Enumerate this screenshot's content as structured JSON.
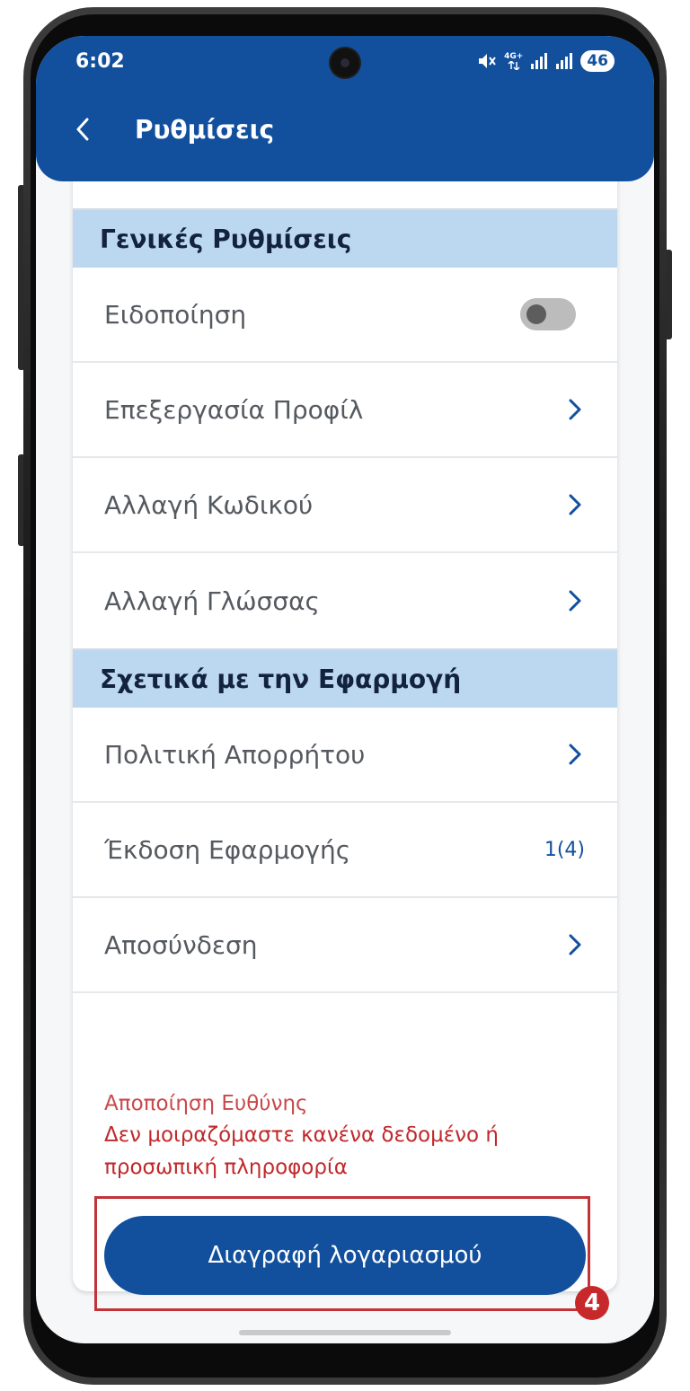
{
  "status_bar": {
    "time": "6:02",
    "network_label": "4G+",
    "battery": "46",
    "icons": [
      "mute-icon",
      "network-4g-icon",
      "signal-icon",
      "signal-icon",
      "battery-icon"
    ]
  },
  "header": {
    "back_icon": "chevron-left-icon",
    "title": "Ρυθμίσεις"
  },
  "sections": [
    {
      "title": "Γενικές Ρυθμίσεις",
      "items": [
        {
          "label": "Ειδοποίηση",
          "control": "toggle",
          "toggle_on": false
        },
        {
          "label": "Επεξεργασία Προφίλ",
          "control": "chevron"
        },
        {
          "label": "Αλλαγή Κωδικού",
          "control": "chevron"
        },
        {
          "label": "Αλλαγή Γλώσσας",
          "control": "chevron"
        }
      ]
    },
    {
      "title": "Σχετικά με την Εφαρμογή",
      "items": [
        {
          "label": "Πολιτική Απορρήτου",
          "control": "chevron"
        },
        {
          "label": "Έκδοση Εφαρμογής",
          "control": "value",
          "value": "1(4)"
        },
        {
          "label": "Αποσύνδεση",
          "control": "chevron"
        }
      ]
    }
  ],
  "disclaimer": {
    "title": "Αποποίηση Ευθύνης",
    "text_line1": "Δεν μοιραζόμαστε κανένα δεδομένο ή",
    "text_line2": "προσωπική πληροφορία"
  },
  "delete_button": {
    "label": "Διαγραφή λογαριασμού"
  },
  "annotation": {
    "step_number": "4"
  },
  "colors": {
    "brand_blue": "#12509e",
    "section_header_bg": "#bcd8f0",
    "warning_red": "#c0292b",
    "highlight_red": "#c23236"
  }
}
